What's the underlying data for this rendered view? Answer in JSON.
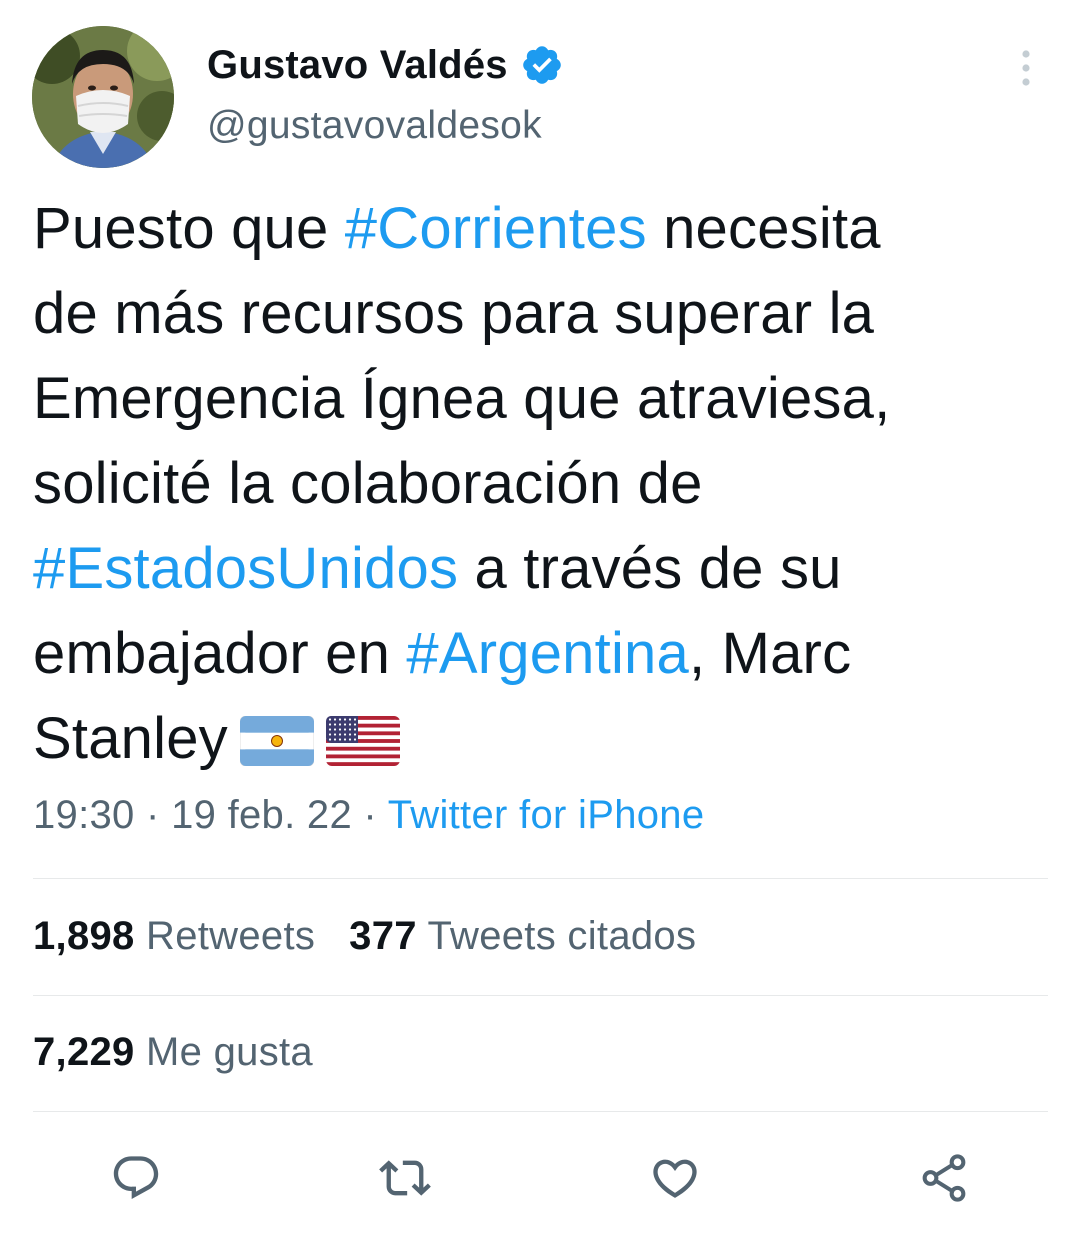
{
  "author": {
    "display_name": "Gustavo Valdés",
    "handle": "@gustavovaldesok",
    "verified": true
  },
  "tweet": {
    "lines": [
      [
        {
          "t": "Puesto que ",
          "tag": false
        },
        {
          "t": "#Corrientes",
          "tag": true
        },
        {
          "t": " necesita",
          "tag": false
        }
      ],
      [
        {
          "t": "de más recursos para superar la",
          "tag": false
        }
      ],
      [
        {
          "t": "Emergencia Ígnea que atraviesa,",
          "tag": false
        }
      ],
      [
        {
          "t": "solicité la colaboración de",
          "tag": false
        }
      ],
      [
        {
          "t": "#EstadosUnidos",
          "tag": true
        },
        {
          "t": " a través de su",
          "tag": false
        }
      ],
      [
        {
          "t": "embajador en ",
          "tag": false
        },
        {
          "t": "#Argentina",
          "tag": true
        },
        {
          "t": ", Marc",
          "tag": false
        }
      ],
      [
        {
          "t": "Stanley",
          "tag": false
        }
      ]
    ],
    "flags": [
      "argentina-flag-icon",
      "usa-flag-icon"
    ]
  },
  "meta": {
    "time": "19:30",
    "date": "19 feb. 22",
    "separator": " · ",
    "source": "Twitter for iPhone"
  },
  "stats": {
    "retweets_count": "1,898",
    "retweets_label": " Retweets",
    "quotes_count": "377",
    "quotes_label": " Tweets citados",
    "likes_count": "7,229",
    "likes_label": " Me gusta"
  },
  "actions": [
    "reply-icon",
    "retweet-icon",
    "like-icon",
    "share-icon"
  ],
  "colors": {
    "link": "#1d9bf0",
    "text": "#0f1419",
    "secondary": "#536471",
    "divider": "#e7e9ea"
  }
}
